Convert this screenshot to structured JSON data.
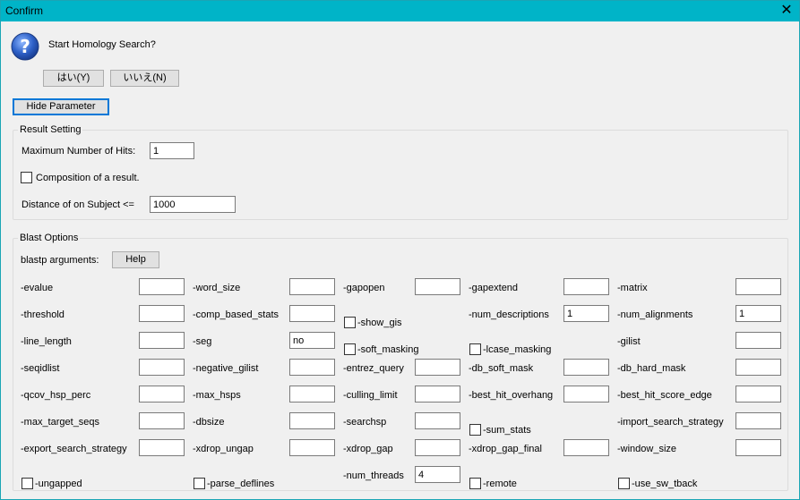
{
  "window": {
    "title": "Confirm"
  },
  "prompt": "Start Homology Search?",
  "buttons": {
    "yes": "はい(Y)",
    "no": "いいえ(N)",
    "hide": "Hide Parameter",
    "help": "Help"
  },
  "result": {
    "legend": "Result Setting",
    "max_hits_label": "Maximum Number of Hits:",
    "max_hits_value": "1",
    "composition_label": "Composition of a result.",
    "distance_label": "Distance of on Subject <=",
    "distance_value": "1000"
  },
  "blast": {
    "legend": "Blast Options",
    "args_label": "blastp arguments:",
    "rows": [
      [
        {
          "label": "-evalue",
          "type": "text",
          "value": ""
        },
        {
          "label": "-word_size",
          "type": "text",
          "value": ""
        },
        {
          "label": "-gapopen",
          "type": "text",
          "value": ""
        },
        {
          "label": "-gapextend",
          "type": "text",
          "value": ""
        },
        {
          "label": "-matrix",
          "type": "text",
          "value": ""
        }
      ],
      [
        {
          "label": "-threshold",
          "type": "text",
          "value": ""
        },
        {
          "label": "-comp_based_stats",
          "type": "text",
          "value": ""
        },
        {
          "label": "-show_gis",
          "type": "check",
          "value": ""
        },
        {
          "label": "-num_descriptions",
          "type": "text",
          "value": "1"
        },
        {
          "label": "-num_alignments",
          "type": "text",
          "value": "1"
        }
      ],
      [
        {
          "label": "-line_length",
          "type": "text",
          "value": ""
        },
        {
          "label": "-seg",
          "type": "text",
          "value": "no"
        },
        {
          "label": "-soft_masking",
          "type": "check",
          "value": ""
        },
        {
          "label": "-lcase_masking",
          "type": "check",
          "value": ""
        },
        {
          "label": "-gilist",
          "type": "text",
          "value": ""
        }
      ],
      [
        {
          "label": "-seqidlist",
          "type": "text",
          "value": ""
        },
        {
          "label": "-negative_gilist",
          "type": "text",
          "value": ""
        },
        {
          "label": "-entrez_query",
          "type": "text",
          "value": ""
        },
        {
          "label": "-db_soft_mask",
          "type": "text",
          "value": ""
        },
        {
          "label": "-db_hard_mask",
          "type": "text",
          "value": ""
        }
      ],
      [
        {
          "label": "-qcov_hsp_perc",
          "type": "text",
          "value": ""
        },
        {
          "label": "-max_hsps",
          "type": "text",
          "value": ""
        },
        {
          "label": "-culling_limit",
          "type": "text",
          "value": ""
        },
        {
          "label": "-best_hit_overhang",
          "type": "text",
          "value": ""
        },
        {
          "label": "-best_hit_score_edge",
          "type": "text",
          "value": ""
        }
      ],
      [
        {
          "label": "-max_target_seqs",
          "type": "text",
          "value": ""
        },
        {
          "label": "-dbsize",
          "type": "text",
          "value": ""
        },
        {
          "label": "-searchsp",
          "type": "text",
          "value": ""
        },
        {
          "label": "-sum_stats",
          "type": "check",
          "value": ""
        },
        {
          "label": "-import_search_strategy",
          "type": "text",
          "value": ""
        }
      ],
      [
        {
          "label": "-export_search_strategy",
          "type": "text",
          "value": ""
        },
        {
          "label": "-xdrop_ungap",
          "type": "text",
          "value": ""
        },
        {
          "label": "-xdrop_gap",
          "type": "text",
          "value": ""
        },
        {
          "label": "-xdrop_gap_final",
          "type": "text",
          "value": ""
        },
        {
          "label": "-window_size",
          "type": "text",
          "value": ""
        }
      ],
      [
        {
          "label": "-ungapped",
          "type": "check",
          "value": ""
        },
        {
          "label": "-parse_deflines",
          "type": "check",
          "value": ""
        },
        {
          "label": "-num_threads",
          "type": "text",
          "value": "4"
        },
        {
          "label": "-remote",
          "type": "check",
          "value": ""
        },
        {
          "label": "-use_sw_tback",
          "type": "check",
          "value": ""
        }
      ]
    ]
  }
}
